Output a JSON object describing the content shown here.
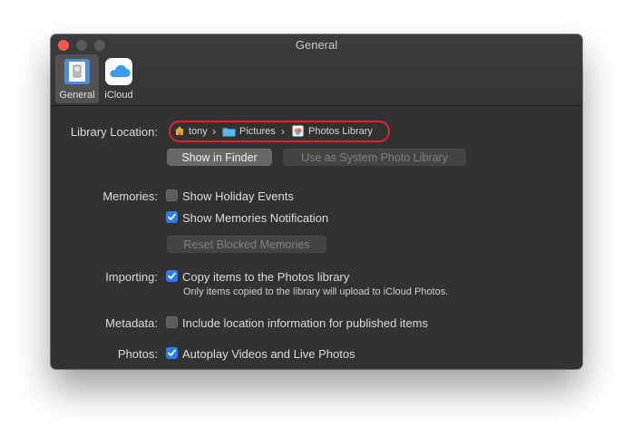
{
  "window": {
    "title": "General",
    "toolbar": [
      {
        "label": "General",
        "icon": "general-switch-icon",
        "selected": true
      },
      {
        "label": "iCloud",
        "icon": "icloud-icon",
        "selected": false
      }
    ]
  },
  "library_location": {
    "label": "Library Location:",
    "path": [
      {
        "label": "tony",
        "icon": "home-icon"
      },
      {
        "label": "Pictures",
        "icon": "folder-icon"
      },
      {
        "label": "Photos Library",
        "icon": "photos-library-icon"
      }
    ],
    "path_separator": "›",
    "show_in_finder": "Show in Finder",
    "use_as_system": "Use as System Photo Library"
  },
  "memories": {
    "label": "Memories:",
    "show_holiday_events": {
      "label": "Show Holiday Events",
      "checked": false
    },
    "show_memories_notification": {
      "label": "Show Memories Notification",
      "checked": true
    },
    "reset_blocked": "Reset Blocked Memories"
  },
  "importing": {
    "label": "Importing:",
    "copy_items": {
      "label": "Copy items to the Photos library",
      "checked": true
    },
    "note": "Only items copied to the library will upload to iCloud Photos."
  },
  "metadata": {
    "label": "Metadata:",
    "include_location": {
      "label": "Include location information for published items",
      "checked": false
    }
  },
  "photos": {
    "label": "Photos:",
    "autoplay": {
      "label": "Autoplay Videos and Live Photos",
      "checked": true
    }
  },
  "colors": {
    "window_bg": "#323232",
    "accent": "#2b7cf1",
    "highlight_ring": "#e0262b",
    "close_button": "#fc5753"
  }
}
